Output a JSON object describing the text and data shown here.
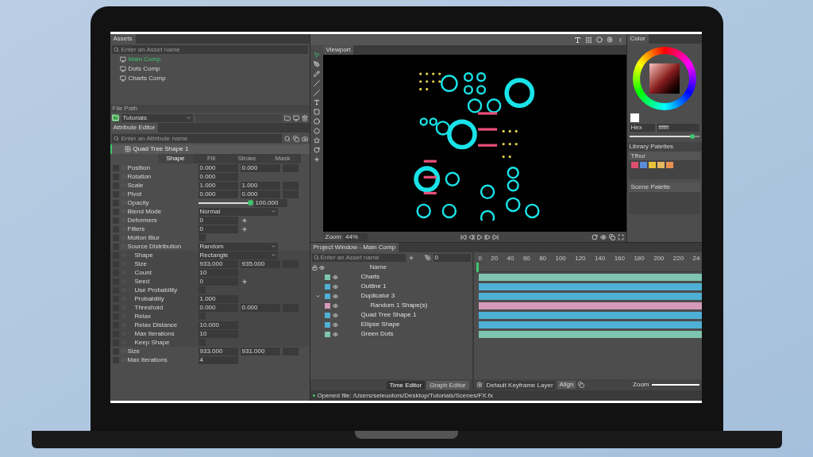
{
  "assets": {
    "tab": "Assets",
    "search_placeholder": "Enter an Asset name",
    "items": [
      {
        "label": "Main Comp",
        "selected": true
      },
      {
        "label": "Dots Comp",
        "selected": false
      },
      {
        "label": "Charts Comp",
        "selected": false
      }
    ],
    "file_path_label": "File Path",
    "folder": "Tutorials"
  },
  "attribute_editor": {
    "tab": "Attribute Editor",
    "search_placeholder": "Enter an Attribute name",
    "layer": "Quad Tree Shape 1",
    "columns": [
      {
        "label": "Shape",
        "selected": true
      },
      {
        "label": "Fill",
        "selected": false
      },
      {
        "label": "Stroke",
        "selected": false
      },
      {
        "label": "Mask",
        "selected": false
      }
    ],
    "rows": [
      {
        "label": "Position",
        "kind": "xy",
        "values": [
          "0.000",
          "0.000"
        ]
      },
      {
        "label": "Rotation",
        "kind": "x",
        "values": [
          "0.000"
        ]
      },
      {
        "label": "Scale",
        "kind": "xy",
        "values": [
          "1.000",
          "1.000"
        ]
      },
      {
        "label": "Pivot",
        "kind": "xy",
        "values": [
          "0.000",
          "0.000"
        ]
      },
      {
        "label": "Opacity",
        "kind": "slider",
        "level": 1,
        "values": [
          "100.000"
        ]
      },
      {
        "label": "Blend Mode",
        "kind": "dropdown",
        "values": [
          "Normal"
        ]
      },
      {
        "label": "Deformers",
        "kind": "count",
        "values": [
          "0"
        ]
      },
      {
        "label": "Filters",
        "kind": "count",
        "values": [
          "0"
        ]
      },
      {
        "label": "Motion Blur",
        "kind": "checkbox",
        "checked": false
      },
      {
        "label": "Source Distribution",
        "kind": "dropdown",
        "values": [
          "Random"
        ],
        "children": [
          {
            "label": "Shape",
            "kind": "dropdown",
            "values": [
              "Rectangle"
            ]
          },
          {
            "label": "Size",
            "kind": "xy",
            "values": [
              "933.000",
              "935.000"
            ]
          },
          {
            "label": "Count",
            "kind": "x",
            "values": [
              "10"
            ]
          },
          {
            "label": "Seed",
            "kind": "count",
            "values": [
              "0"
            ]
          },
          {
            "label": "Use Probability",
            "kind": "checkbox",
            "checked": false
          },
          {
            "label": "Probability",
            "kind": "x",
            "values": [
              "1.000"
            ]
          },
          {
            "label": "Threshold",
            "kind": "xy",
            "values": [
              "0.000",
              "0.000"
            ]
          },
          {
            "label": "Relax",
            "kind": "checkbox",
            "checked": false
          },
          {
            "label": "Relax Distance",
            "kind": "x",
            "values": [
              "10.000"
            ]
          },
          {
            "label": "Max Iterations",
            "kind": "x",
            "values": [
              "10"
            ]
          },
          {
            "label": "Keep Shape",
            "kind": "checkbox",
            "checked": false
          }
        ]
      },
      {
        "label": "Size",
        "kind": "xy",
        "values": [
          "933.000",
          "931.000"
        ]
      },
      {
        "label": "Max Iterations",
        "kind": "x",
        "values": [
          "4"
        ]
      }
    ]
  },
  "viewport": {
    "tab": "Viewport",
    "zoom_label": "Zoom",
    "zoom_value": "44%"
  },
  "color": {
    "tab": "Color",
    "mode": "Hex",
    "hex": "ffffff",
    "level": 0.9,
    "library_label": "Library Palettes",
    "palette": "Tfhur",
    "swatches": [
      {
        "color": "#e0506e"
      },
      {
        "color": "#5b8ad6"
      },
      {
        "color": "#e8c238"
      },
      {
        "color": "#e6b860"
      },
      {
        "color": "#e89050"
      }
    ],
    "scene_label": "Scene Palette"
  },
  "project": {
    "tab": "Project Window - Main Comp",
    "search_placeholder": "Enter an Asset name",
    "frame": "0",
    "name_header": "Name",
    "ruler": [
      "0",
      "20",
      "40",
      "60",
      "80",
      "100",
      "120",
      "140",
      "160",
      "180",
      "200",
      "220",
      "24"
    ],
    "layers": [
      {
        "name": "Charts",
        "color": "#7fc4b0"
      },
      {
        "name": "Outline 1",
        "color": "#4fb0d6"
      },
      {
        "name": "Duplicator 3",
        "color": "#4fb0d6",
        "expanded": true,
        "children": [
          {
            "name": "Random 1 Shape(s)",
            "color": "#d49ab8"
          }
        ]
      },
      {
        "name": "Quad Tree Shape 1",
        "color": "#4fb0d6"
      },
      {
        "name": "Ellipse Shape",
        "color": "#4fb0d6"
      },
      {
        "name": "Green Dots",
        "color": "#7fc4b0"
      }
    ],
    "editors": [
      {
        "label": "Time Editor",
        "selected": true
      },
      {
        "label": "Graph Editor",
        "selected": false
      }
    ],
    "keyframe_layer": "Default Keyframe Layer",
    "align": "Align",
    "zoom_label": "Zoom",
    "zoom_slider": {
      "level": 1
    }
  },
  "status_bar": "Opened file: /Users/seleuotors/Desktop/Tutorials/Scenes/FX.fx"
}
